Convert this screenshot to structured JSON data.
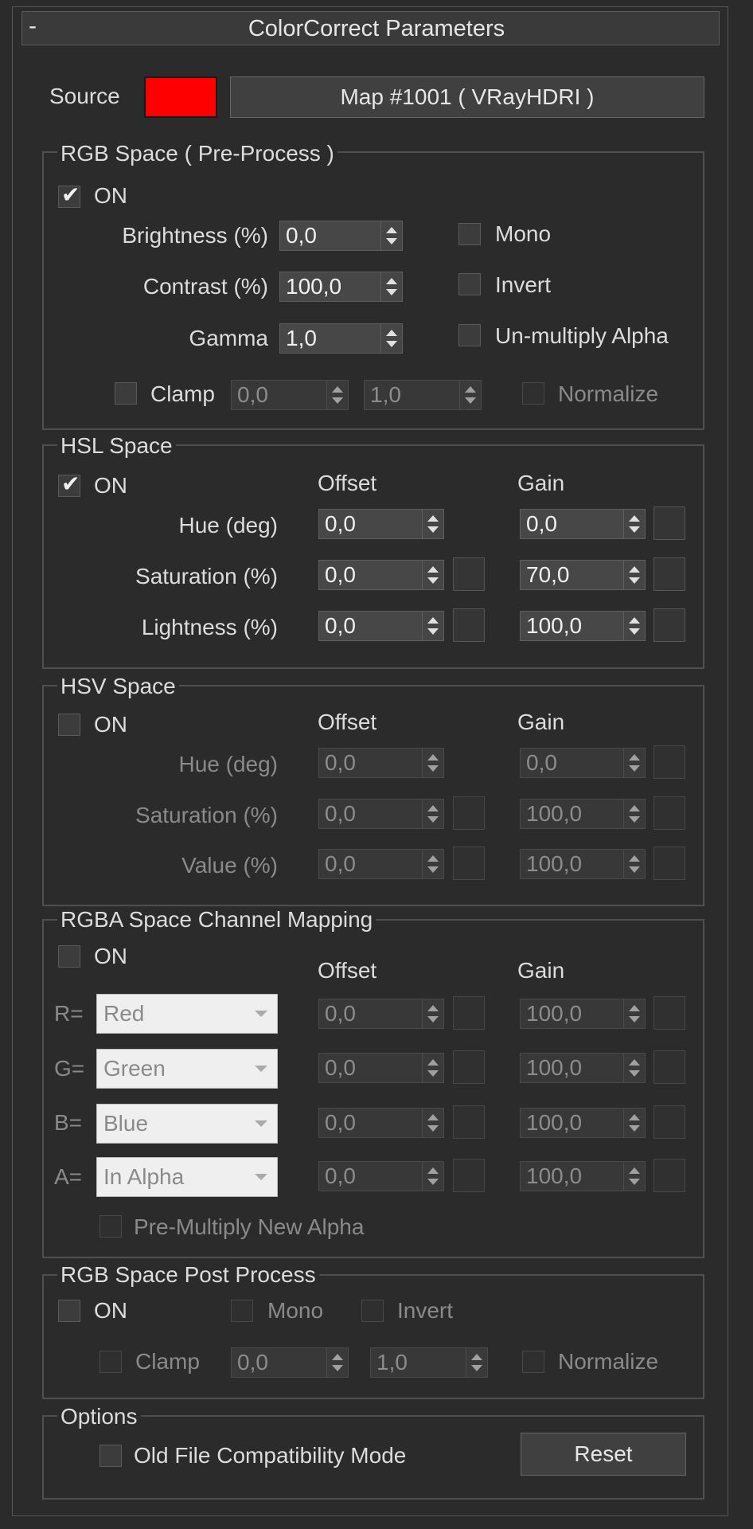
{
  "rollout": {
    "toggle": "-",
    "title": "ColorCorrect Parameters"
  },
  "source": {
    "label": "Source",
    "swatch_color": "#ff0000",
    "map_button": "Map #1001  ( VRayHDRI )"
  },
  "rgb_pre": {
    "title": "RGB Space ( Pre-Process )",
    "on": {
      "label": "ON",
      "checked": true
    },
    "brightness": {
      "label": "Brightness (%)",
      "value": "0,0"
    },
    "contrast": {
      "label": "Contrast (%)",
      "value": "100,0"
    },
    "gamma": {
      "label": "Gamma",
      "value": "1,0"
    },
    "mono": {
      "label": "Mono",
      "checked": false
    },
    "invert": {
      "label": "Invert",
      "checked": false
    },
    "unmultiply": {
      "label": "Un-multiply Alpha",
      "checked": false
    },
    "clamp": {
      "label": "Clamp",
      "checked": false,
      "min": "0,0",
      "max": "1,0"
    },
    "normalize": {
      "label": "Normalize",
      "checked": false
    }
  },
  "hsl": {
    "title": "HSL Space",
    "on": {
      "label": "ON",
      "checked": true
    },
    "offset_header": "Offset",
    "gain_header": "Gain",
    "rows": [
      {
        "label": "Hue (deg)",
        "offset": "0,0",
        "gain": "0,0"
      },
      {
        "label": "Saturation (%)",
        "offset": "0,0",
        "gain": "70,0"
      },
      {
        "label": "Lightness (%)",
        "offset": "0,0",
        "gain": "100,0"
      }
    ]
  },
  "hsv": {
    "title": "HSV Space",
    "on": {
      "label": "ON",
      "checked": false
    },
    "offset_header": "Offset",
    "gain_header": "Gain",
    "rows": [
      {
        "label": "Hue (deg)",
        "offset": "0,0",
        "gain": "0,0"
      },
      {
        "label": "Saturation (%)",
        "offset": "0,0",
        "gain": "100,0"
      },
      {
        "label": "Value (%)",
        "offset": "0,0",
        "gain": "100,0"
      }
    ]
  },
  "rgba_map": {
    "title": "RGBA Space Channel Mapping",
    "on": {
      "label": "ON",
      "checked": false
    },
    "offset_header": "Offset",
    "gain_header": "Gain",
    "rows": [
      {
        "label": "R=",
        "channel": "Red",
        "offset": "0,0",
        "gain": "100,0"
      },
      {
        "label": "G=",
        "channel": "Green",
        "offset": "0,0",
        "gain": "100,0"
      },
      {
        "label": "B=",
        "channel": "Blue",
        "offset": "0,0",
        "gain": "100,0"
      },
      {
        "label": "A=",
        "channel": "In Alpha",
        "offset": "0,0",
        "gain": "100,0"
      }
    ],
    "premultiply": {
      "label": "Pre-Multiply New Alpha",
      "checked": false
    }
  },
  "rgb_post": {
    "title": "RGB Space Post Process",
    "on": {
      "label": "ON",
      "checked": false
    },
    "mono": {
      "label": "Mono",
      "checked": false
    },
    "invert": {
      "label": "Invert",
      "checked": false
    },
    "clamp": {
      "label": "Clamp",
      "checked": false,
      "min": "0,0",
      "max": "1,0"
    },
    "normalize": {
      "label": "Normalize",
      "checked": false
    }
  },
  "options": {
    "title": "Options",
    "old_file": {
      "label": "Old File Compatibility Mode",
      "checked": false
    },
    "reset": "Reset"
  }
}
